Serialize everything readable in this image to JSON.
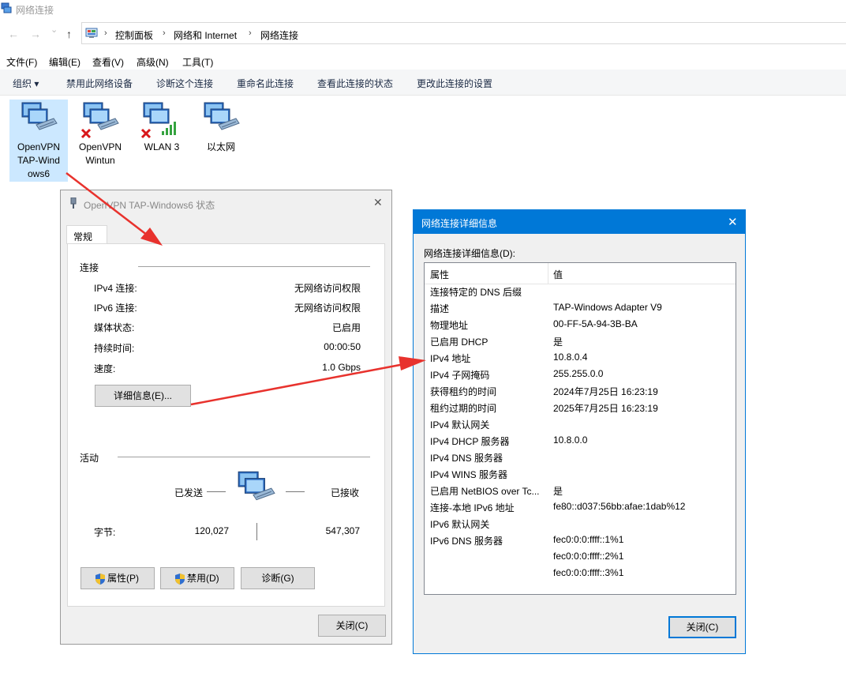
{
  "window": {
    "title": "网络连接"
  },
  "nav": {
    "back": "←",
    "forward": "→",
    "recent": "⌄",
    "up": "↑",
    "breadcrumb": [
      "控制面板",
      "网络和 Internet",
      "网络连接"
    ],
    "sep": "›"
  },
  "menu": [
    "文件(F)",
    "编辑(E)",
    "查看(V)",
    "高级(N)",
    "工具(T)"
  ],
  "commands": [
    "组织 ▾",
    "禁用此网络设备",
    "诊断这个连接",
    "重命名此连接",
    "查看此连接的状态",
    "更改此连接的设置"
  ],
  "adapters": [
    {
      "label": "OpenVPN TAP-Windows6",
      "lines": [
        "OpenVPN",
        "TAP-Wind",
        "ows6"
      ],
      "selected": true,
      "status": "none"
    },
    {
      "label": "OpenVPN Wintun",
      "lines": [
        "OpenVPN",
        "Wintun"
      ],
      "selected": false,
      "status": "disconnected"
    },
    {
      "label": "WLAN 3",
      "lines": [
        "WLAN 3"
      ],
      "selected": false,
      "status": "disconnected-wifi"
    },
    {
      "label": "以太网",
      "lines": [
        "以太网"
      ],
      "selected": false,
      "status": "none"
    }
  ],
  "status_dialog": {
    "title": "OpenVPN TAP-Windows6 状态",
    "tab": "常规",
    "connection_group": "连接",
    "rows": [
      {
        "k": "IPv4 连接:",
        "v": "无网络访问权限"
      },
      {
        "k": "IPv6 连接:",
        "v": "无网络访问权限"
      },
      {
        "k": "媒体状态:",
        "v": "已启用"
      },
      {
        "k": "持续时间:",
        "v": "00:00:50"
      },
      {
        "k": "速度:",
        "v": "1.0 Gbps"
      }
    ],
    "details_button": "详细信息(E)...",
    "activity_group": "活动",
    "sent_label": "已发送",
    "received_label": "已接收",
    "bytes_label": "字节:",
    "bytes_sent": "120,027",
    "bytes_received": "547,307",
    "buttons": [
      "属性(P)",
      "禁用(D)",
      "诊断(G)"
    ],
    "close": "关闭(C)"
  },
  "details_dialog": {
    "title": "网络连接详细信息",
    "list_label": "网络连接详细信息(D):",
    "col_property": "属性",
    "col_value": "值",
    "rows": [
      {
        "p": "连接特定的 DNS 后缀",
        "v": ""
      },
      {
        "p": "描述",
        "v": "TAP-Windows Adapter V9"
      },
      {
        "p": "物理地址",
        "v": "00-FF-5A-94-3B-BA"
      },
      {
        "p": "已启用 DHCP",
        "v": "是"
      },
      {
        "p": "IPv4 地址",
        "v": "10.8.0.4"
      },
      {
        "p": "IPv4 子网掩码",
        "v": "255.255.0.0"
      },
      {
        "p": "获得租约的时间",
        "v": "2024年7月25日 16:23:19"
      },
      {
        "p": "租约过期的时间",
        "v": "2025年7月25日 16:23:19"
      },
      {
        "p": "IPv4 默认网关",
        "v": ""
      },
      {
        "p": "IPv4 DHCP 服务器",
        "v": "10.8.0.0"
      },
      {
        "p": "IPv4 DNS 服务器",
        "v": ""
      },
      {
        "p": "IPv4 WINS 服务器",
        "v": ""
      },
      {
        "p": "已启用 NetBIOS over Tc...",
        "v": "是"
      },
      {
        "p": "连接-本地 IPv6 地址",
        "v": "fe80::d037:56bb:afae:1dab%12"
      },
      {
        "p": "IPv6 默认网关",
        "v": ""
      },
      {
        "p": "IPv6 DNS 服务器",
        "v": "fec0:0:0:ffff::1%1"
      },
      {
        "p": "",
        "v": "fec0:0:0:ffff::2%1"
      },
      {
        "p": "",
        "v": "fec0:0:0:ffff::3%1"
      }
    ],
    "close": "关闭(C)"
  },
  "colors": {
    "accent": "#0078d7",
    "arrow": "#e8322d",
    "selection": "#cce8ff"
  }
}
